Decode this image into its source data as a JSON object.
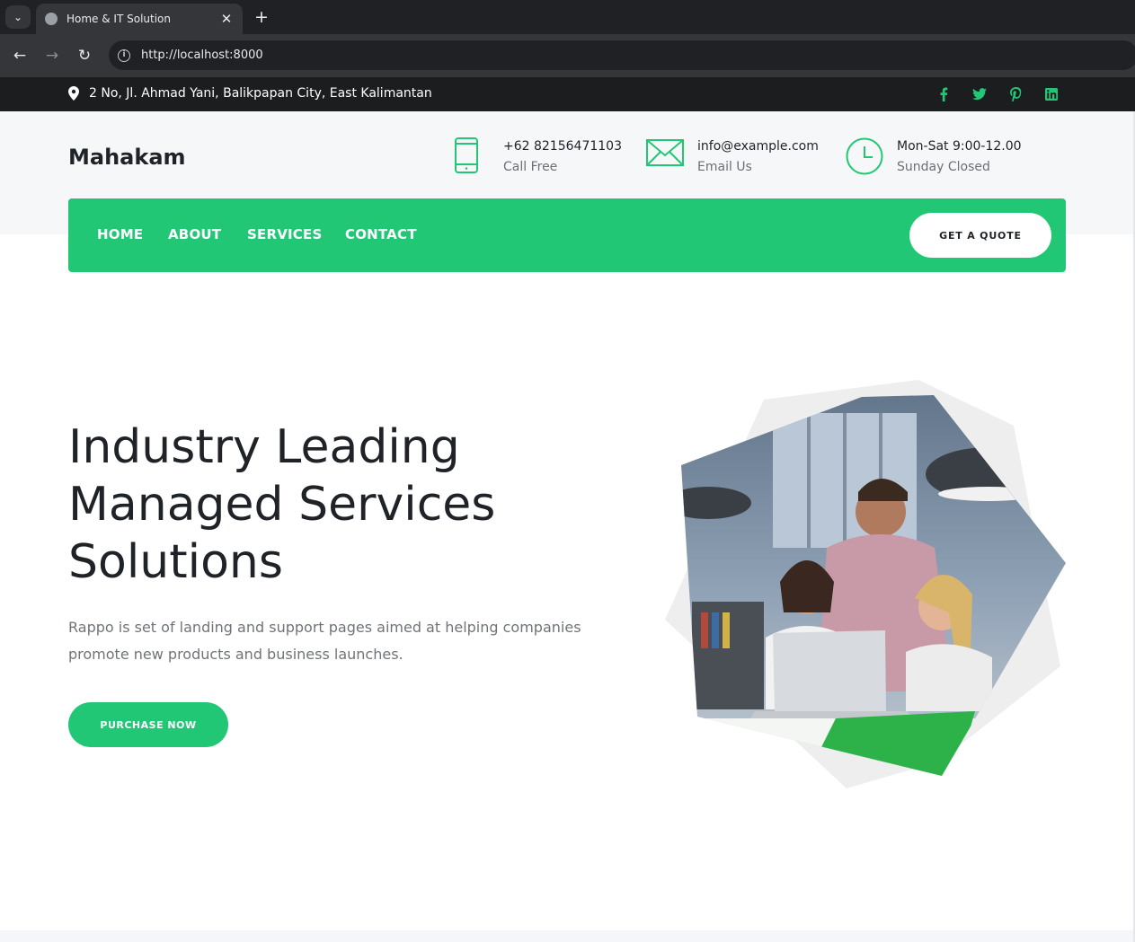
{
  "browser": {
    "tab_title": "Home & IT Solution",
    "url": "http://localhost:8000"
  },
  "topbar": {
    "address": "2 No, Jl. Ahmad Yani, Balikpapan City, East Kalimantan",
    "socials": [
      "facebook-icon",
      "twitter-icon",
      "pinterest-icon",
      "linkedin-icon"
    ],
    "social_color": "#22c776"
  },
  "header": {
    "brand": "Mahakam",
    "phone": {
      "main": "+62 82156471103",
      "sub": "Call Free"
    },
    "email": {
      "main": "info@example.com",
      "sub": "Email Us"
    },
    "hours": {
      "main": "Mon-Sat 9:00-12.00",
      "sub": "Sunday Closed"
    }
  },
  "nav": {
    "items": [
      "HOME",
      "ABOUT",
      "SERVICES",
      "CONTACT"
    ],
    "quote_label": "GET A QUOTE",
    "accent": "#22c776"
  },
  "hero": {
    "title_line1": "Industry Leading",
    "title_line2": "Managed Services",
    "title_line3": "Solutions",
    "text": "Rappo is set of landing and support pages aimed at helping companies promote new products and business launches.",
    "cta_label": "PURCHASE NOW"
  }
}
